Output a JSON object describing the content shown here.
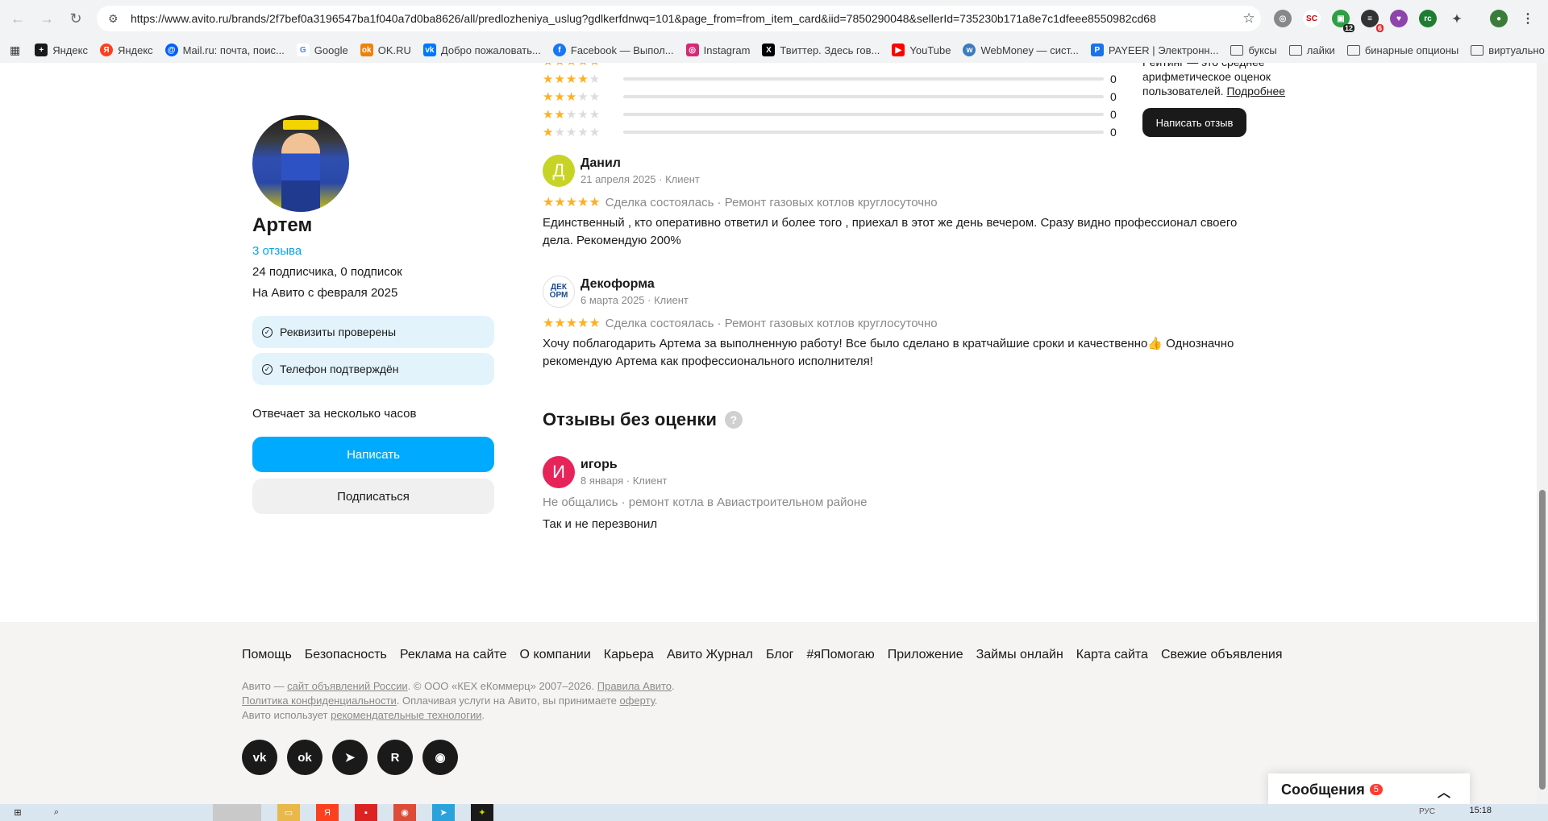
{
  "browser": {
    "url": "https://www.avito.ru/brands/2f7bef0a3196547ba1f040a7d0ba8626/all/predlozheniya_uslug?gdlkerfdnwq=101&page_from=from_item_card&iid=7850290048&sellerId=735230b171a8e7c1dfeee8550982cd68",
    "extensions": [
      {
        "name": "translate-icon",
        "badge": ""
      },
      {
        "name": "sc-extension-icon",
        "badge": ""
      },
      {
        "name": "ext-green-icon",
        "badge": "12"
      },
      {
        "name": "ext-list-icon",
        "badge": "6"
      },
      {
        "name": "ext-purple-heart-icon",
        "badge": ""
      },
      {
        "name": "ext-rc-icon",
        "badge": ""
      },
      {
        "name": "extensions-puzzle-icon",
        "badge": ""
      },
      {
        "name": "profile-avatar-icon",
        "badge": ""
      }
    ]
  },
  "bookmarks": [
    {
      "label": "Яндекс",
      "icon": "yandex-black-icon",
      "color": "#1a1a1a"
    },
    {
      "label": "Яндекс",
      "icon": "yandex-red-icon",
      "color": "#fc3f1d"
    },
    {
      "label": "Mail.ru: почта, поис...",
      "icon": "mailru-icon",
      "color": "#005ff9"
    },
    {
      "label": "Google",
      "icon": "google-icon",
      "color": "#4285f4"
    },
    {
      "label": "OK.RU",
      "icon": "ok-icon",
      "color": "#ee8208"
    },
    {
      "label": "Добро пожаловать...",
      "icon": "vk-icon",
      "color": "#0077ff"
    },
    {
      "label": "Facebook — Выпол...",
      "icon": "facebook-icon",
      "color": "#1877f2"
    },
    {
      "label": "Instagram",
      "icon": "instagram-icon",
      "color": "#d62976"
    },
    {
      "label": "Твиттер. Здесь гов...",
      "icon": "x-icon",
      "color": "#000000"
    },
    {
      "label": "YouTube",
      "icon": "youtube-icon",
      "color": "#ff0000"
    },
    {
      "label": "WebMoney — сист...",
      "icon": "webmoney-icon",
      "color": "#3b7bbf"
    },
    {
      "label": "PAYEER | Электронн...",
      "icon": "payeer-icon",
      "color": "#1a73e8"
    },
    {
      "label": "буксы",
      "icon": "folder-icon",
      "color": ""
    },
    {
      "label": "лайки",
      "icon": "folder-icon",
      "color": ""
    },
    {
      "label": "бинарные опционы",
      "icon": "folder-icon",
      "color": ""
    },
    {
      "label": "виртуально",
      "icon": "folder-icon",
      "color": ""
    }
  ],
  "profile": {
    "name": "Артем",
    "reviews_count": "3 отзыва",
    "subscribers": "24 подписчика, 0 подписок",
    "since": "На Авито с февраля 2025",
    "badges": [
      "Реквизиты проверены",
      "Телефон подтверждён"
    ],
    "responds": "Отвечает за несколько часов",
    "write_button": "Написать",
    "subscribe_button": "Подписаться",
    "accent": "#00aaff"
  },
  "rating": {
    "rows": [
      {
        "stars": 4,
        "count": "0"
      },
      {
        "stars": 3,
        "count": "0"
      },
      {
        "stars": 2,
        "count": "0"
      },
      {
        "stars": 1,
        "count": "0"
      }
    ],
    "note_line1": "Рейтинг — это среднее",
    "note_line2": "арифметическое оценок",
    "note_line3": "пользователей.",
    "note_link": "Подробнее",
    "write_review_button": "Написать отзыв",
    "star_color": "#ffb021"
  },
  "reviews": [
    {
      "avatar_letter": "Д",
      "avatar_color": "#c7d425",
      "name": "Данил",
      "meta": "21 апреля 2025 · Клиент",
      "deal": "Сделка состоялась · Ремонт газовых котлов круглосуточно",
      "text": "Единственный , кто оперативно ответил и более того , приехал в этот же день вечером. Сразу видно профессионал своего дела. Рекомендую 200%"
    },
    {
      "avatar_letter": "ДЕК ОРМ",
      "avatar_color": "#ffffff",
      "name": "Декоформа",
      "meta": "6 марта 2025 · Клиент",
      "deal": "Сделка состоялась · Ремонт газовых котлов круглосуточно",
      "text": "Хочу поблагодарить Артема за выполненную работу! Все было сделано в кратчайшие сроки и качественно👍 Однозначно рекомендую Артема как профессионального исполнителя!"
    }
  ],
  "unrated": {
    "title": "Отзывы без оценки",
    "help_icon": "?",
    "review": {
      "avatar_letter": "И",
      "avatar_color": "#e6245a",
      "name": "игорь",
      "meta": "8 января · Клиент",
      "deal": "Не общались · ремонт котла в Авиастроительном районе",
      "text": "Так и не перезвонил"
    }
  },
  "footer": {
    "links": [
      "Помощь",
      "Безопасность",
      "Реклама на сайте",
      "О компании",
      "Карьера",
      "Авито Журнал",
      "Блог",
      "#яПомогаю",
      "Приложение",
      "Займы онлайн",
      "Карта сайта",
      "Свежие объявления"
    ],
    "legal1_pre": "Авито — ",
    "legal1_link1": "сайт объявлений России",
    "legal1_mid": ". © ООО «КЕХ еКоммерц» 2007–2026. ",
    "legal1_link2": "Правила Авито",
    "legal1_end": ".",
    "legal2_link1": "Политика конфиденциальности",
    "legal2_mid": ". Оплачивая услуги на Авито, вы принимаете ",
    "legal2_link2": "оферту",
    "legal2_end": ".",
    "legal3_pre": "Авито использует ",
    "legal3_link": "рекомендательные технологии",
    "legal3_end": ".",
    "socials": [
      {
        "name": "vk-icon",
        "glyph": "vk"
      },
      {
        "name": "odnoklassniki-icon",
        "glyph": "ok"
      },
      {
        "name": "telegram-icon",
        "glyph": "➤"
      },
      {
        "name": "rutube-icon",
        "glyph": "R"
      },
      {
        "name": "dzen-icon",
        "glyph": "◉"
      }
    ]
  },
  "messages_widget": {
    "label": "Сообщения",
    "count": "5"
  },
  "taskbar": {
    "time": "15:18",
    "lang": "РУС"
  }
}
